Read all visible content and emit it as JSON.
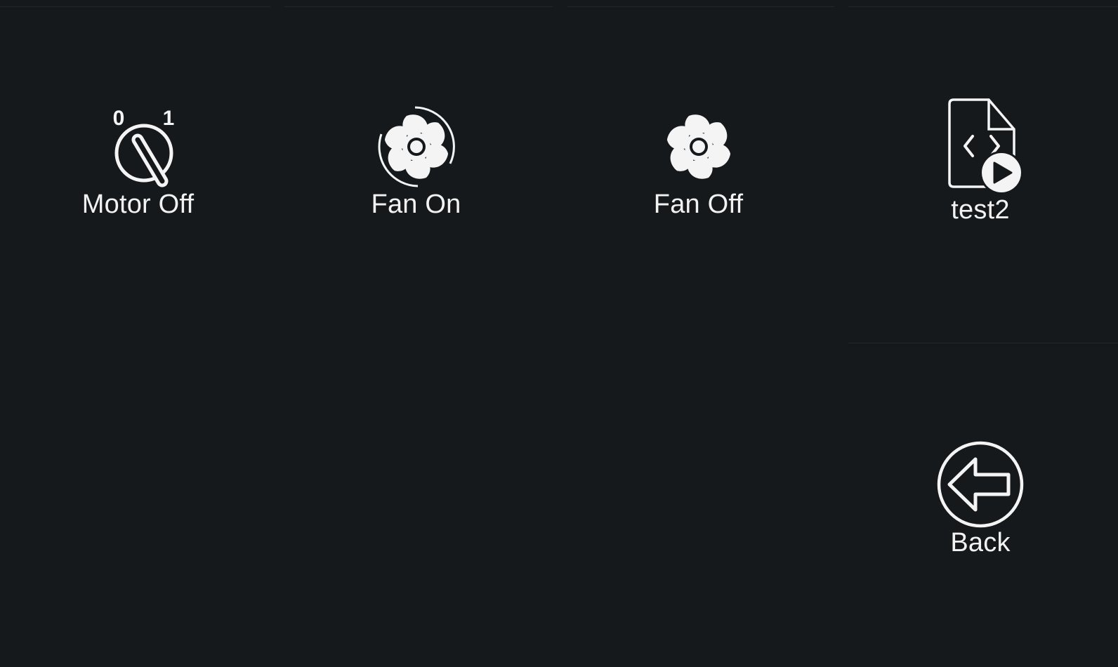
{
  "colors": {
    "background": "#15191c",
    "foreground": "#f4f4f4",
    "separator": "#22272b"
  },
  "buttons": [
    {
      "label": "Motor Off",
      "icon": "rotary-switch-icon",
      "dial_labels": [
        "0",
        "1"
      ]
    },
    {
      "label": "Fan On",
      "icon": "fan-running-icon"
    },
    {
      "label": "Fan Off",
      "icon": "fan-icon"
    },
    {
      "label": "test2",
      "icon": "run-script-icon"
    },
    {
      "label": "Back",
      "icon": "back-arrow-icon"
    }
  ]
}
